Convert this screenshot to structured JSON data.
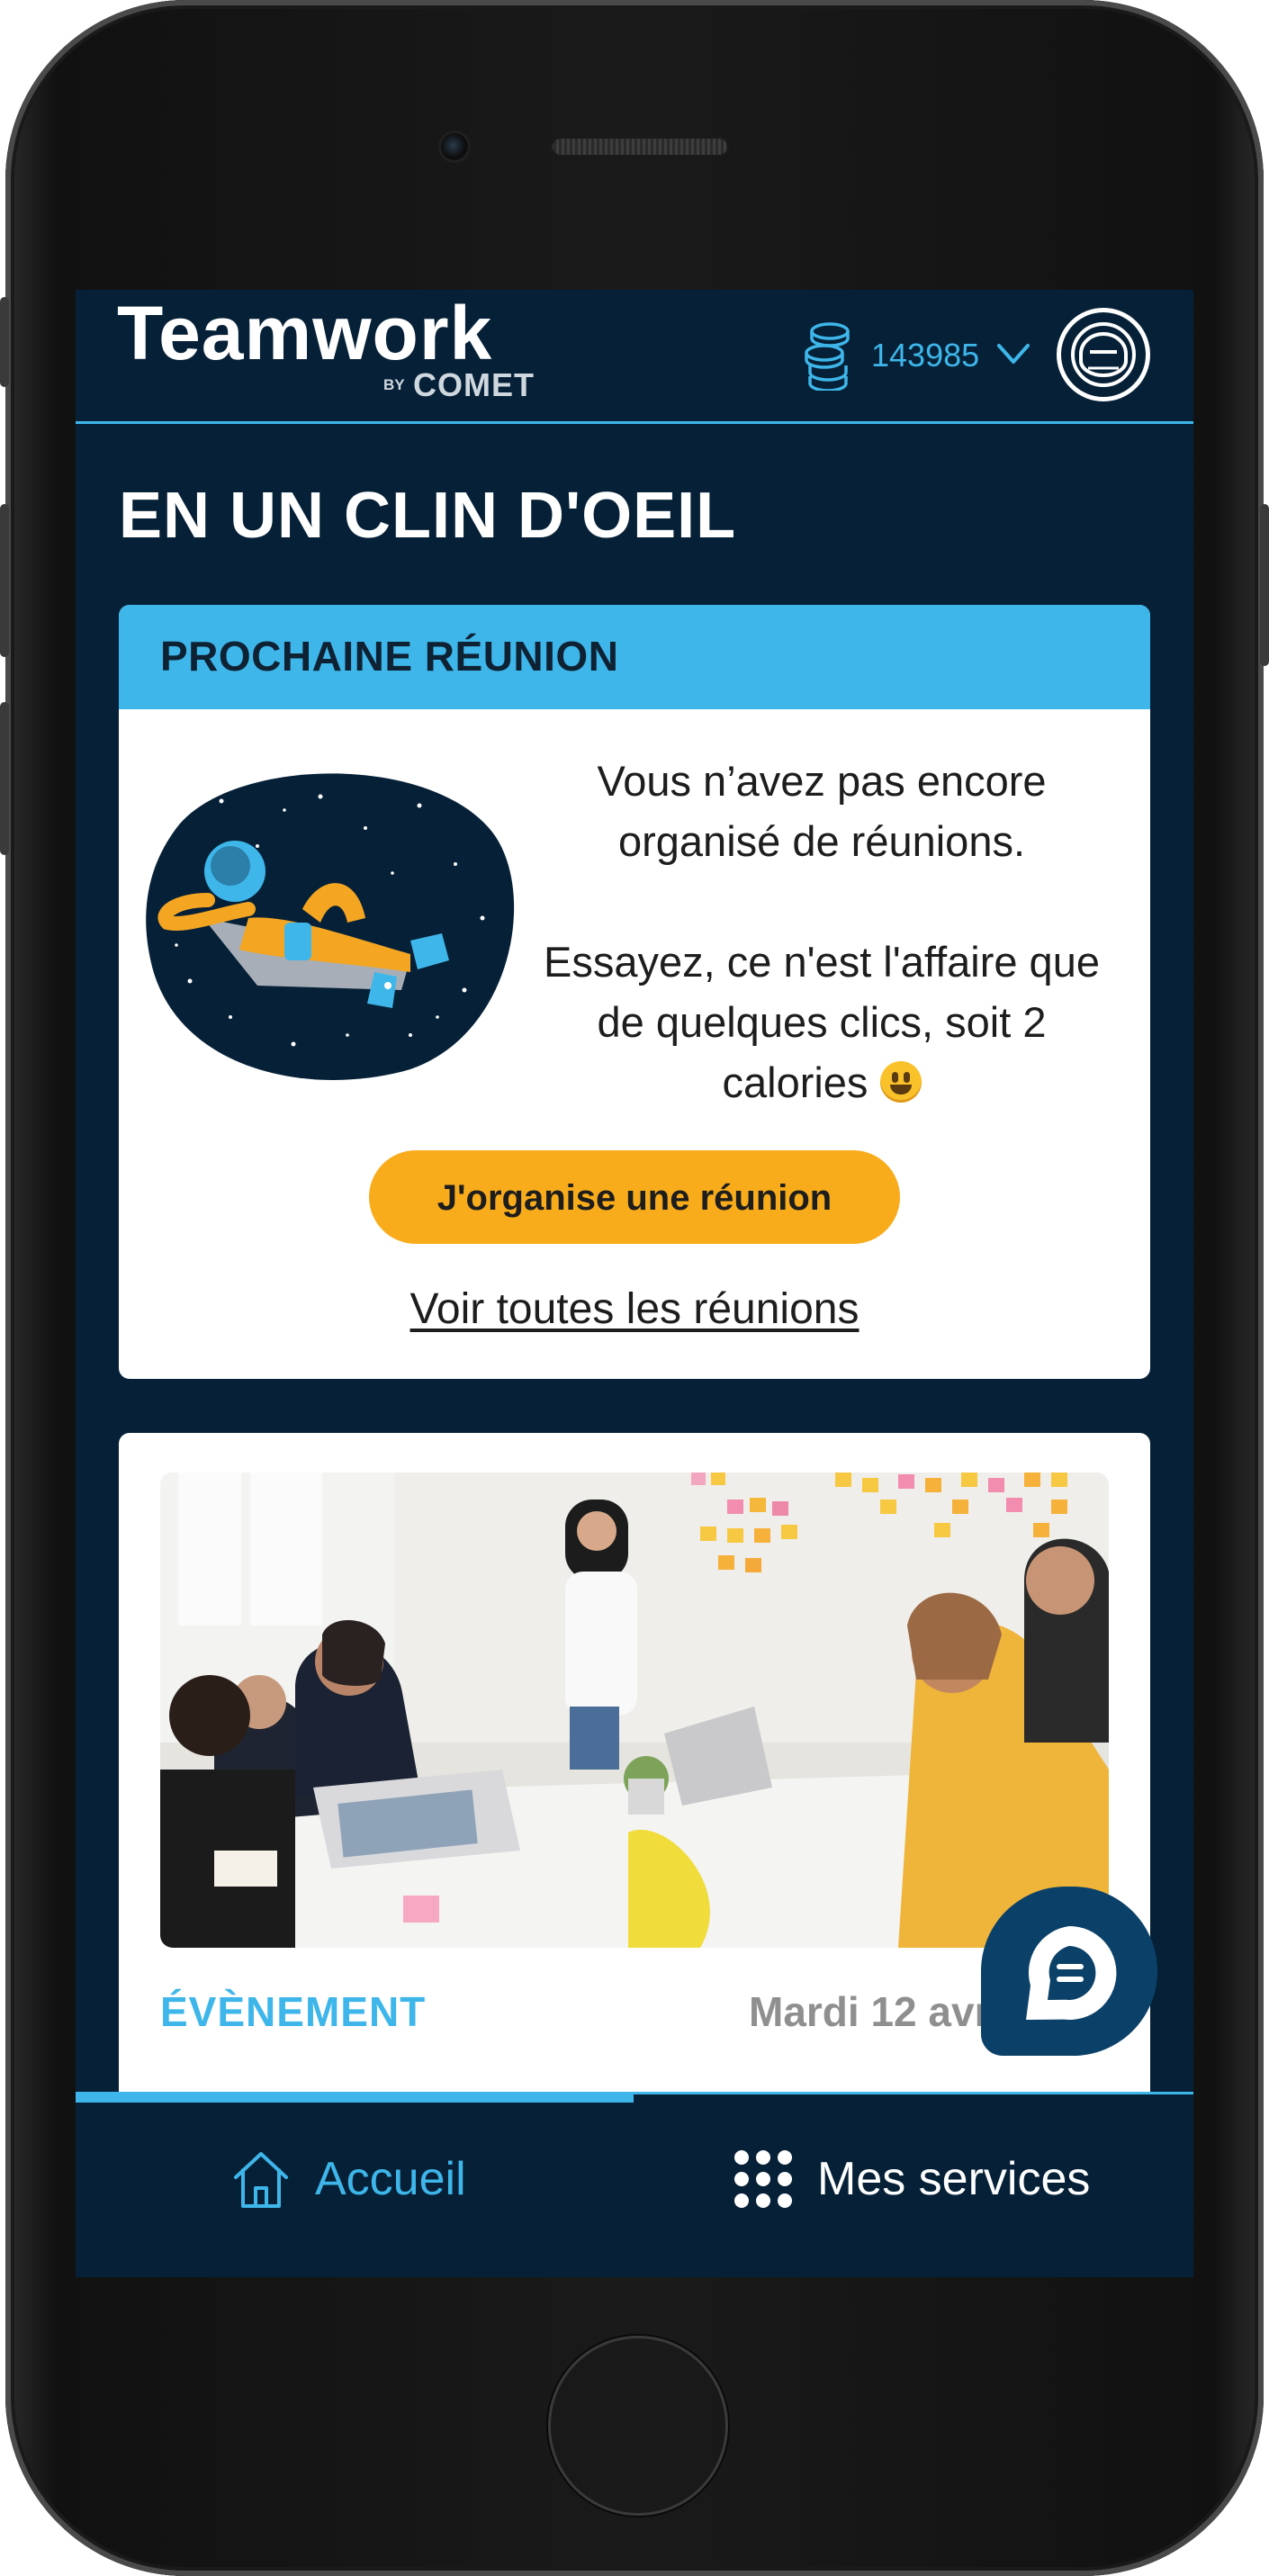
{
  "header": {
    "logo_main": "Teamwork",
    "logo_by": "BY",
    "logo_sub": "COMET",
    "coins_value": "143985",
    "icons": [
      "coins-icon",
      "chevron-down-icon",
      "astronaut-avatar-icon"
    ]
  },
  "page": {
    "title": "EN UN CLIN D'OEIL"
  },
  "next_meeting": {
    "title": "PROCHAINE RÉUNION",
    "message_line1": "Vous n’avez pas encore organisé de réunions.",
    "message_line2": "Essayez, ce n'est l'affaire que de quelques clics, soit 2 calories",
    "emoji": "grinning-face-emoji",
    "cta_label": "J'organise une réunion",
    "link_label": "Voir toutes les réunions"
  },
  "event_card": {
    "label": "ÉVÈNEMENT",
    "date": "Mardi 12 avril, 1"
  },
  "chat": {
    "icon": "chat-bubble-icon"
  },
  "bottom_nav": {
    "items": [
      {
        "label": "Accueil",
        "icon": "home-icon",
        "active": true
      },
      {
        "label": "Mes services",
        "icon": "grid-icon",
        "active": false
      }
    ]
  },
  "colors": {
    "background": "#062137",
    "accent": "#3eb6ea",
    "cta": "#f8ac1c",
    "fab": "#0b4168"
  }
}
